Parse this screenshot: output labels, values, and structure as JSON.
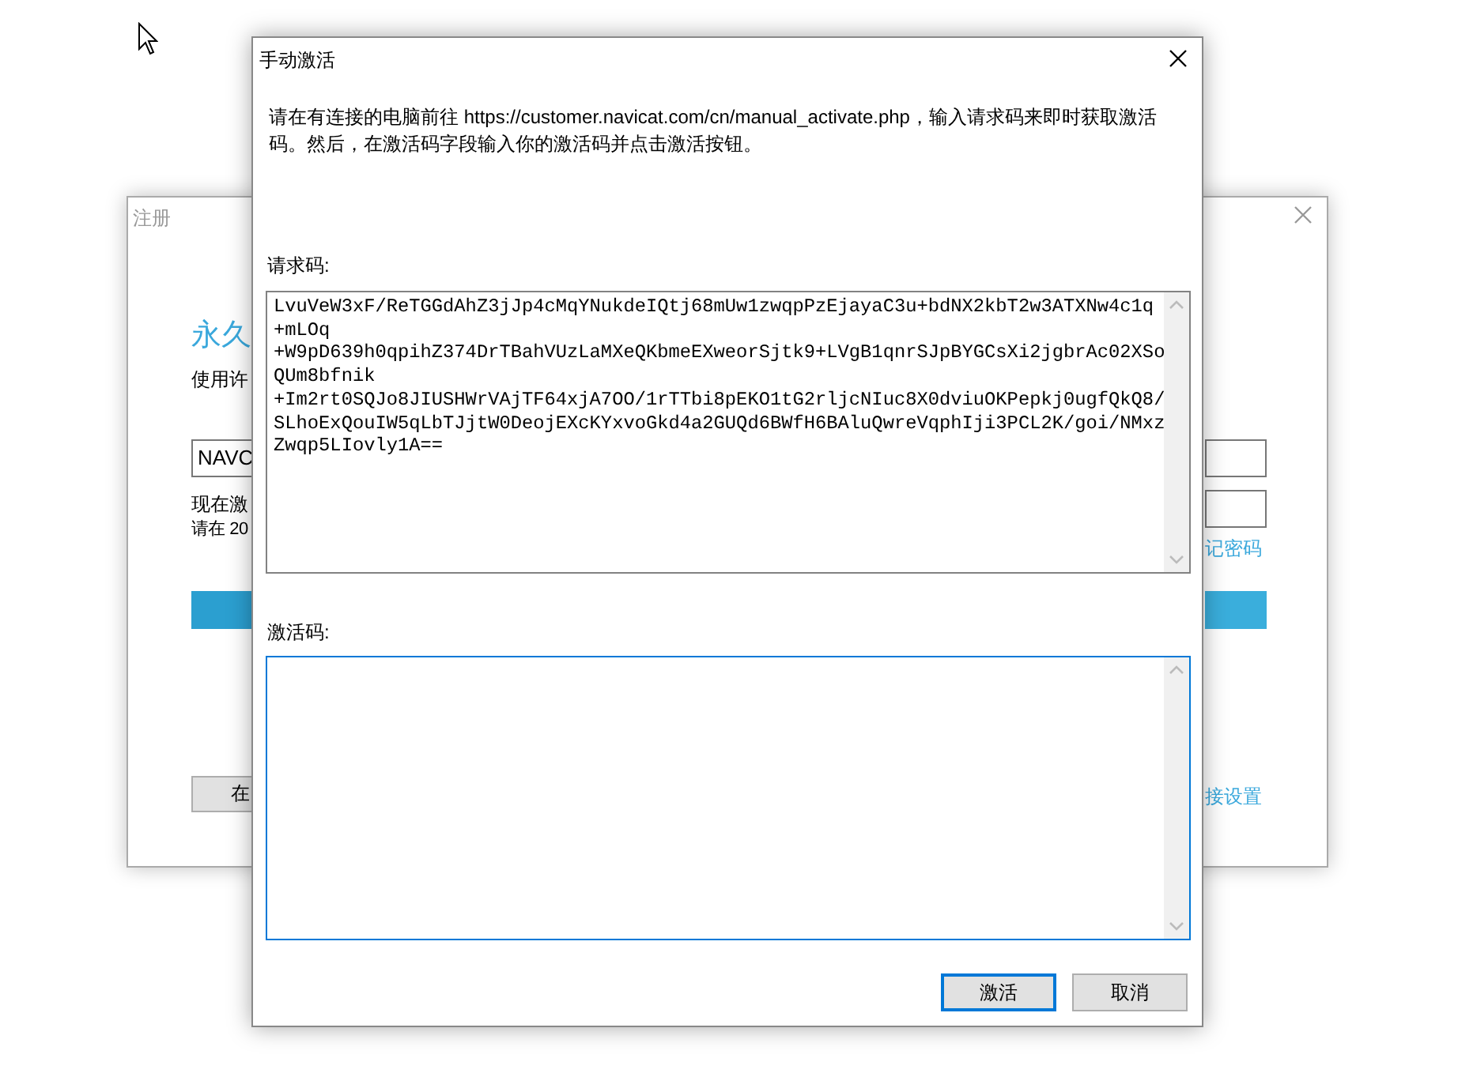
{
  "background_dialog": {
    "title": "注册",
    "heading": "永久",
    "subtitle": "使用许",
    "license_field": {
      "value": "NAVC"
    },
    "note_1": "现在激",
    "note_2": "请在 20",
    "forgot_link": "记密码",
    "button": "在",
    "settings_link": "接设置"
  },
  "dialog": {
    "title": "手动激活",
    "instructions": "请在有连接的电脑前往 https://customer.navicat.com/cn/manual_activate.php，输入请求码来即时获取激活码。然后，在激活码字段输入你的激活码并点击激活按钮。",
    "request_label": "请求码:",
    "request_code": "LvuVeW3xF/ReTGGdAhZ3jJp4cMqYNukdeIQtj68mUw1zwqpPzEjayaC3u+bdNX2kbT2w3ATXNw4c1q\n+mLOq\n+W9pD639h0qpihZ374DrTBahVUzLaMXeQKbmeEXweorSjtk9+LVgB1qnrSJpBYGCsXi2jgbrAc02XSo\nQUm8bfnik\n+Im2rt0SQJo8JIUSHWrVAjTF64xjA7OO/1rTTbi8pEKO1tG2rljcNIuc8X0dviuOKPepkj0ugfQkQ8/\nSLhoExQouIW5qLbTJjtW0DeojEXcKYxvoGkd4a2GUQd6BWfH6BAluQwreVqphIji3PCL2K/goi/NMxz\nZwqp5LIovly1A==",
    "activation_label": "激活码:",
    "activation_code": {
      "focused": true
    },
    "buttons": [
      {
        "label": "激活",
        "selected": true
      },
      {
        "label": "取消",
        "selected": false
      }
    ]
  }
}
